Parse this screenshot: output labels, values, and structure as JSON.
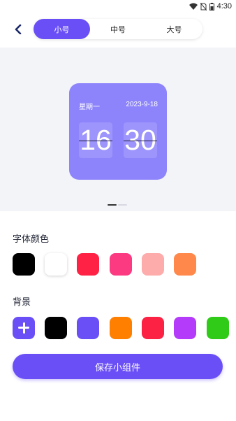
{
  "status_bar": {
    "time": "4:30"
  },
  "size_tabs": [
    {
      "label": "小号",
      "selected": true
    },
    {
      "label": "中号",
      "selected": false
    },
    {
      "label": "大号",
      "selected": false
    }
  ],
  "widget": {
    "weekday": "星期一",
    "date": "2023-9-18",
    "hours": "16",
    "minutes": "30",
    "background_color": "#8d84fb"
  },
  "font_color_section": {
    "title": "字体颜色",
    "colors": [
      "#000000",
      "#ffffff",
      "#ff2244",
      "#fc3a82",
      "#fdabab",
      "#ff884a"
    ]
  },
  "background_section": {
    "title": "背景",
    "add_icon": "plus-icon",
    "colors": [
      "#000000",
      "#6b4ff6",
      "#ff7f00",
      "#fc2243",
      "#b43bfa",
      "#2fcb18"
    ]
  },
  "save_button": {
    "label": "保存小组件"
  },
  "accent_color": "#6b4ff6"
}
